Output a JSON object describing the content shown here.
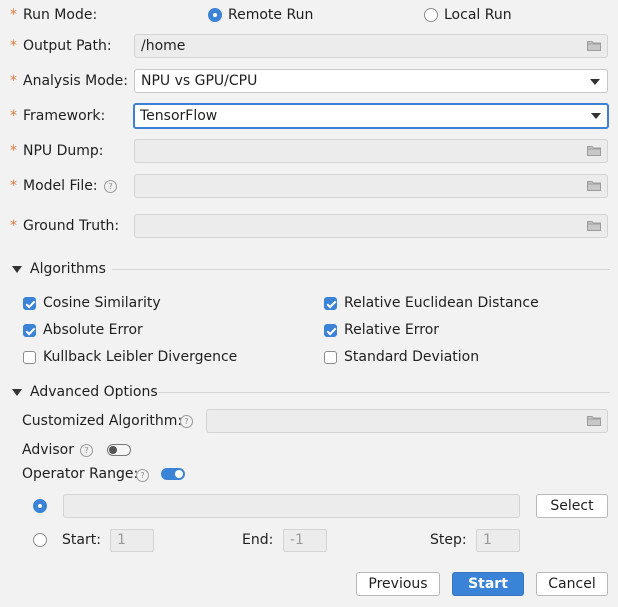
{
  "run_mode": {
    "label": "Run Mode:",
    "remote": "Remote Run",
    "local": "Local Run",
    "selected": "remote"
  },
  "output_path": {
    "label": "Output Path:",
    "value": "/home"
  },
  "analysis_mode": {
    "label": "Analysis Mode:",
    "value": "NPU vs GPU/CPU"
  },
  "framework": {
    "label": "Framework:",
    "value": "TensorFlow"
  },
  "npu_dump": {
    "label": "NPU Dump:",
    "value": ""
  },
  "model_file": {
    "label": "Model File:",
    "value": ""
  },
  "ground_truth": {
    "label": "Ground Truth:",
    "value": ""
  },
  "algorithms": {
    "title": "Algorithms",
    "items": [
      {
        "label": "Cosine Similarity",
        "checked": true
      },
      {
        "label": "Relative Euclidean Distance",
        "checked": true
      },
      {
        "label": "Absolute Error",
        "checked": true
      },
      {
        "label": "Relative Error",
        "checked": true
      },
      {
        "label": "Kullback Leibler Divergence",
        "checked": false
      },
      {
        "label": "Standard Deviation",
        "checked": false
      }
    ]
  },
  "advanced": {
    "title": "Advanced Options",
    "customized_label": "Customized Algorithm:",
    "advisor_label": "Advisor",
    "advisor_on": false,
    "operator_range_label": "Operator Range:",
    "operator_range_on": true,
    "select_button": "Select",
    "start_label": "Start:",
    "start_value": "1",
    "end_label": "End:",
    "end_value": "-1",
    "step_label": "Step:",
    "step_value": "1"
  },
  "help_glyph": "?",
  "buttons": {
    "previous": "Previous",
    "start": "Start",
    "cancel": "Cancel"
  },
  "colors": {
    "accent": "#3b83d6",
    "required_star": "#e07b39"
  }
}
